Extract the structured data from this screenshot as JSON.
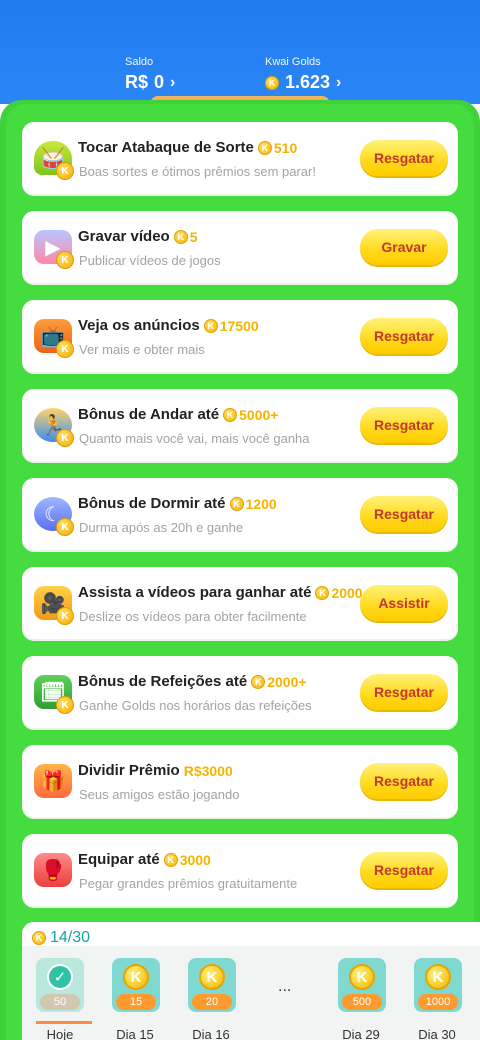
{
  "header": {
    "balance_label": "Saldo",
    "balance_currency": "R$",
    "balance_value": "0",
    "golds_label": "Kwai Golds",
    "golds_value": "1.623",
    "chevron": "›"
  },
  "tasks": [
    {
      "title": "Tocar Atabaque de Sorte",
      "reward": "510",
      "subtitle": "Boas sortes e ótimos prêmios sem parar!",
      "button": "Resgatar",
      "icon": "drum-icon"
    },
    {
      "title": "Gravar vídeo",
      "reward": "5",
      "subtitle": "Publicar vídeos de jogos",
      "button": "Gravar",
      "icon": "video-record-icon"
    },
    {
      "title": "Veja os anúncios",
      "reward": "17500",
      "subtitle": "Ver mais e obter mais",
      "button": "Resgatar",
      "icon": "tv-ad-icon"
    },
    {
      "title": "Bônus de Andar até",
      "reward": "5000+",
      "subtitle": "Quanto mais você vai, mais você ganha",
      "button": "Resgatar",
      "icon": "walking-boy-icon"
    },
    {
      "title": "Bônus de Dormir até",
      "reward": "1200",
      "subtitle": "Durma após as 20h e ganhe",
      "button": "Resgatar",
      "icon": "moon-sleep-icon"
    },
    {
      "title": "Assista a vídeos para ganhar até",
      "reward": "2000",
      "subtitle": "Deslize os vídeos para obter facilmente",
      "button": "Assistir",
      "icon": "camera-icon"
    },
    {
      "title": "Bônus de Refeições até",
      "reward": "2000+",
      "subtitle": "Ganhe Golds nos horários das refeições",
      "button": "Resgatar",
      "icon": "meal-calendar-icon"
    },
    {
      "title": "Dividir Prêmio",
      "reward": "R$3000",
      "subtitle": "Seus amigos estão jogando",
      "button": "Resgatar",
      "icon": "gift-box-icon"
    },
    {
      "title": "Equipar até",
      "reward": "3000",
      "subtitle": "Pegar grandes prêmios gratuitamente",
      "button": "Resgatar",
      "icon": "boxing-glove-icon"
    }
  ],
  "checkin": {
    "progress": "14/30",
    "ellipsis": "...",
    "days": [
      {
        "label": "Hoje",
        "amount": "50",
        "done": true
      },
      {
        "label": "Dia 15",
        "amount": "15",
        "done": false
      },
      {
        "label": "Dia 16",
        "amount": "20",
        "done": false
      },
      {
        "label": "Dia 29",
        "amount": "500",
        "done": false
      },
      {
        "label": "Dia 30",
        "amount": "1000",
        "done": false
      }
    ]
  },
  "colors": {
    "header_blue": "#2b86f6",
    "board_green": "#3fd23a",
    "button_yellow": "#ffd91a",
    "button_text": "#c0392b",
    "reward_gold": "#f4b400",
    "progress_teal": "#1aa2a0"
  }
}
